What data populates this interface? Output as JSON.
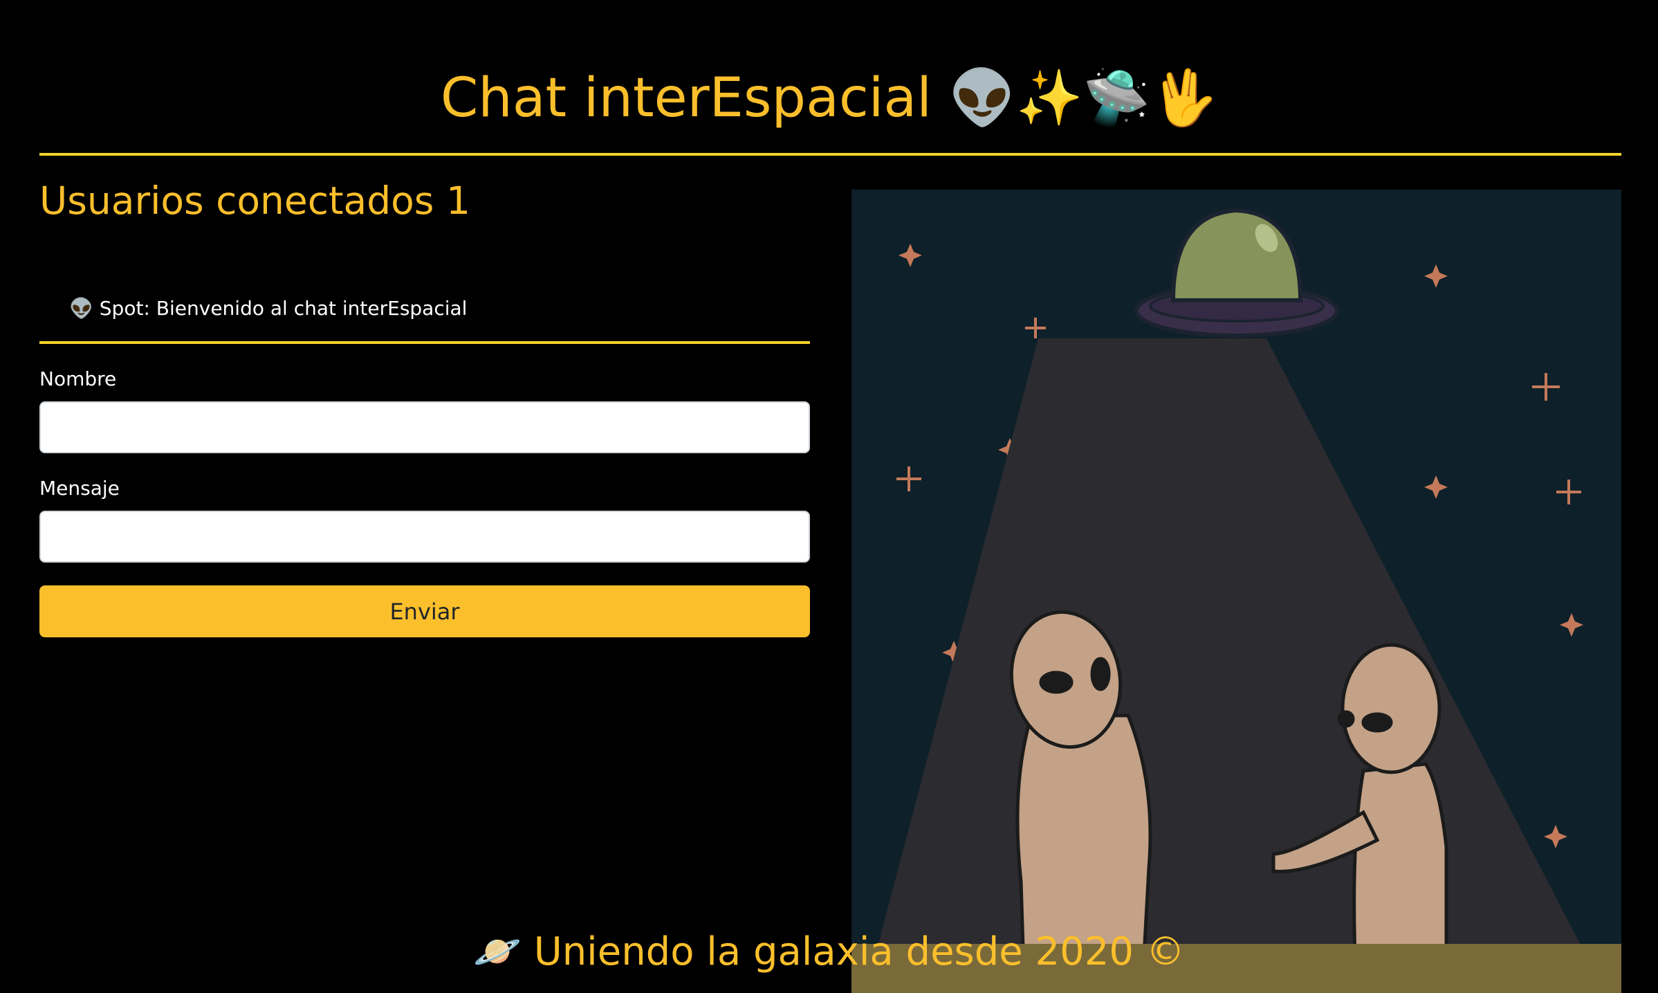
{
  "header": {
    "title": "Chat interEspacial 👽✨🛸🖖"
  },
  "sidebar": {
    "users_label": "Usuarios conectados",
    "users_count": "1"
  },
  "chat": {
    "messages": [
      {
        "icon": "👽",
        "author": "Spot:",
        "text": "Bienvenido al chat interEspacial"
      }
    ]
  },
  "form": {
    "name_label": "Nombre",
    "name_value": "",
    "message_label": "Mensaje",
    "message_value": "",
    "submit_label": "Enviar"
  },
  "illustration": {
    "subject": "two-aliens-under-ufo-beam"
  },
  "footer": {
    "text": "🪐 Uniendo la galaxia desde 2020 ©"
  },
  "colors": {
    "accent": "#fbbf2c",
    "divider": "#f5d328",
    "background": "#000000",
    "night_sky": "#0e2029"
  }
}
